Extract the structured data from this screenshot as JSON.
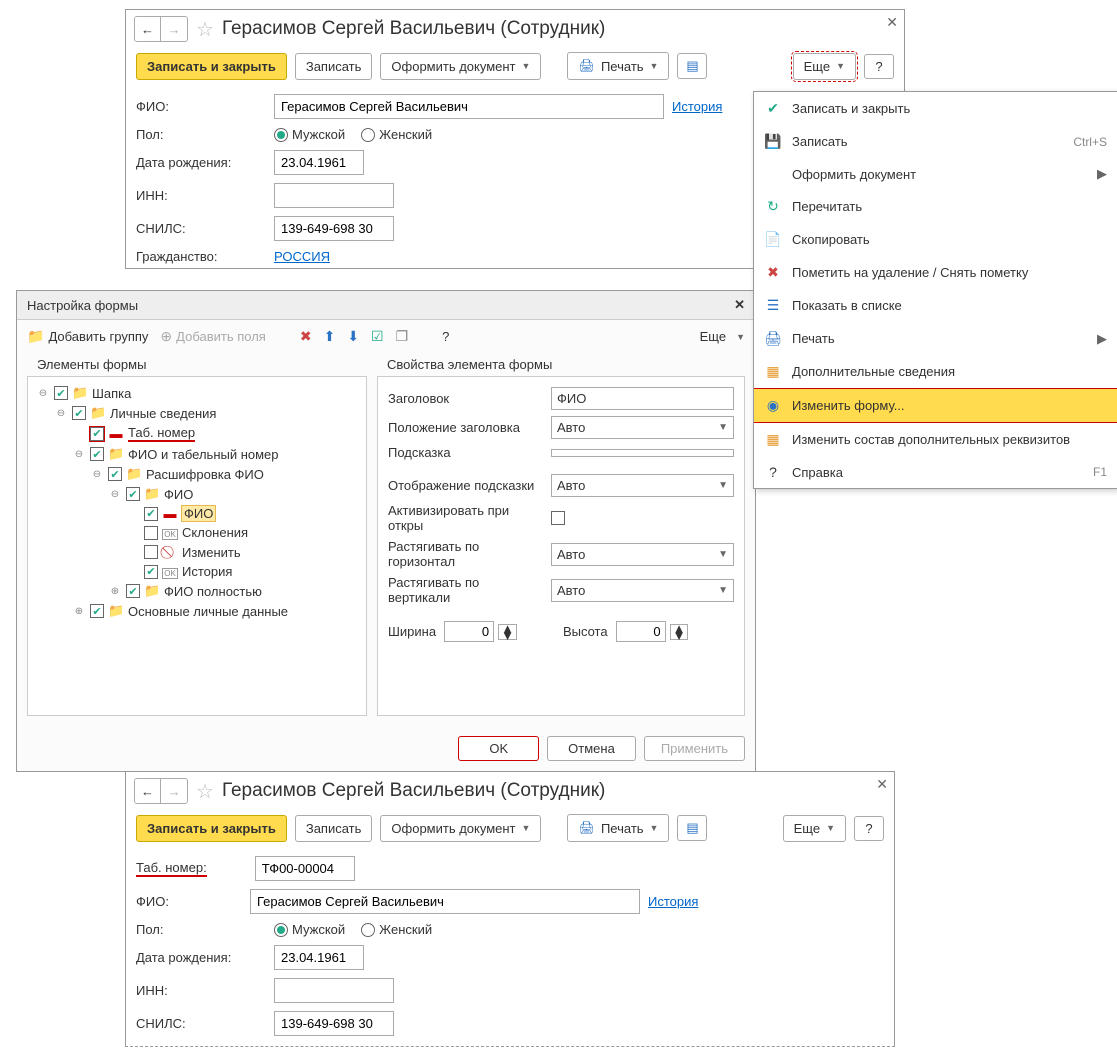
{
  "window1": {
    "title": "Герасимов Сергей Васильевич (Сотрудник)",
    "toolbar": {
      "save_close": "Записать и закрыть",
      "save": "Записать",
      "make_doc": "Оформить документ",
      "print": "Печать",
      "more": "Еще",
      "help": "?"
    },
    "form": {
      "fio_label": "ФИО:",
      "fio_value": "Герасимов Сергей Васильевич",
      "history": "История",
      "pol_label": "Пол:",
      "male": "Мужской",
      "female": "Женский",
      "dob_label": "Дата рождения:",
      "dob_value": "23.04.1961",
      "inn_label": "ИНН:",
      "inn_value": "",
      "snils_label": "СНИЛС:",
      "snils_value": "139-649-698 30",
      "citizenship_label": "Гражданство:",
      "citizenship_value": "РОССИЯ"
    }
  },
  "dropdown": {
    "items": [
      {
        "icon": "✔",
        "icon_class": "icon-green",
        "label": "Записать и закрыть"
      },
      {
        "icon": "💾",
        "icon_class": "icon-blue",
        "label": "Записать",
        "shortcut": "Ctrl+S"
      },
      {
        "icon": "",
        "label": "Оформить документ",
        "submenu": true
      },
      {
        "icon": "↻",
        "icon_class": "icon-green",
        "label": "Перечитать"
      },
      {
        "icon": "📄",
        "icon_class": "icon-green",
        "label": "Скопировать"
      },
      {
        "icon": "✖",
        "icon_class": "icon-red",
        "label": "Пометить на удаление / Снять пометку"
      },
      {
        "icon": "☰",
        "icon_class": "icon-blue",
        "label": "Показать в списке"
      },
      {
        "icon": "🖨",
        "icon_class": "icon-blue",
        "label": "Печать",
        "submenu": true
      },
      {
        "icon": "▦",
        "icon_class": "icon-orange",
        "label": "Дополнительные сведения"
      },
      {
        "icon": "◉",
        "icon_class": "icon-blue",
        "label": "Изменить форму...",
        "highlighted": true
      },
      {
        "icon": "▦",
        "icon_class": "icon-orange",
        "label": "Изменить состав дополнительных реквизитов"
      },
      {
        "icon": "?",
        "label": "Справка",
        "shortcut": "F1"
      }
    ]
  },
  "modal": {
    "title": "Настройка формы",
    "toolbar": {
      "add_group": "Добавить группу",
      "add_fields": "Добавить поля",
      "more": "Еще",
      "help": "?"
    },
    "panel_headers": {
      "left": "Элементы формы",
      "right": "Свойства элемента формы"
    },
    "tree": [
      {
        "level": 0,
        "exp": "⊖",
        "checked": true,
        "icon": "📁",
        "label": "Шапка"
      },
      {
        "level": 1,
        "exp": "⊖",
        "checked": true,
        "icon": "📁",
        "label": "Личные сведения"
      },
      {
        "level": 2,
        "exp": "",
        "checked": true,
        "checked_red": true,
        "icon": "minus",
        "label": "Таб. номер",
        "label_red": true
      },
      {
        "level": 2,
        "exp": "⊖",
        "checked": true,
        "icon": "📁",
        "label": "ФИО и табельный номер"
      },
      {
        "level": 3,
        "exp": "⊖",
        "checked": true,
        "icon": "📁",
        "label": "Расшифровка ФИО"
      },
      {
        "level": 4,
        "exp": "⊖",
        "checked": true,
        "icon": "📁",
        "label": "ФИО"
      },
      {
        "level": 5,
        "exp": "",
        "checked": true,
        "icon": "minus",
        "label": "ФИО",
        "hl": true
      },
      {
        "level": 5,
        "exp": "",
        "checked": false,
        "icon": "ok",
        "label": "Склонения"
      },
      {
        "level": 5,
        "exp": "",
        "checked": false,
        "icon": "slash",
        "label": "Изменить"
      },
      {
        "level": 5,
        "exp": "",
        "checked": true,
        "icon": "ok",
        "label": "История"
      },
      {
        "level": 4,
        "exp": "⊕",
        "checked": true,
        "icon": "📁",
        "label": "ФИО полностью"
      },
      {
        "level": 2,
        "exp": "⊕",
        "checked": true,
        "icon": "📁",
        "label": "Основные личные данные"
      }
    ],
    "props": {
      "title_label": "Заголовок",
      "title_value": "ФИО",
      "title_pos_label": "Положение заголовка",
      "title_pos_value": "Авто",
      "hint_label": "Подсказка",
      "hint_value": "",
      "hint_disp_label": "Отображение подсказки",
      "hint_disp_value": "Авто",
      "activate_label": "Активизировать при откры",
      "stretch_h_label": "Растягивать по горизонтал",
      "stretch_h_value": "Авто",
      "stretch_v_label": "Растягивать по вертикали",
      "stretch_v_value": "Авто",
      "width_label": "Ширина",
      "width_value": "0",
      "height_label": "Высота",
      "height_value": "0"
    },
    "footer": {
      "ok": "OK",
      "cancel": "Отмена",
      "apply": "Применить"
    }
  },
  "window3": {
    "title": "Герасимов Сергей Васильевич (Сотрудник)",
    "toolbar": {
      "save_close": "Записать и закрыть",
      "save": "Записать",
      "make_doc": "Оформить документ",
      "print": "Печать",
      "more": "Еще",
      "help": "?"
    },
    "form": {
      "tabno_label": "Таб. номер:",
      "tabno_value": "ТФ00-00004",
      "fio_label": "ФИО:",
      "fio_value": "Герасимов Сергей Васильевич",
      "history": "История",
      "pol_label": "Пол:",
      "male": "Мужской",
      "female": "Женский",
      "dob_label": "Дата рождения:",
      "dob_value": "23.04.1961",
      "inn_label": "ИНН:",
      "inn_value": "",
      "snils_label": "СНИЛС:",
      "snils_value": "139-649-698 30"
    }
  }
}
